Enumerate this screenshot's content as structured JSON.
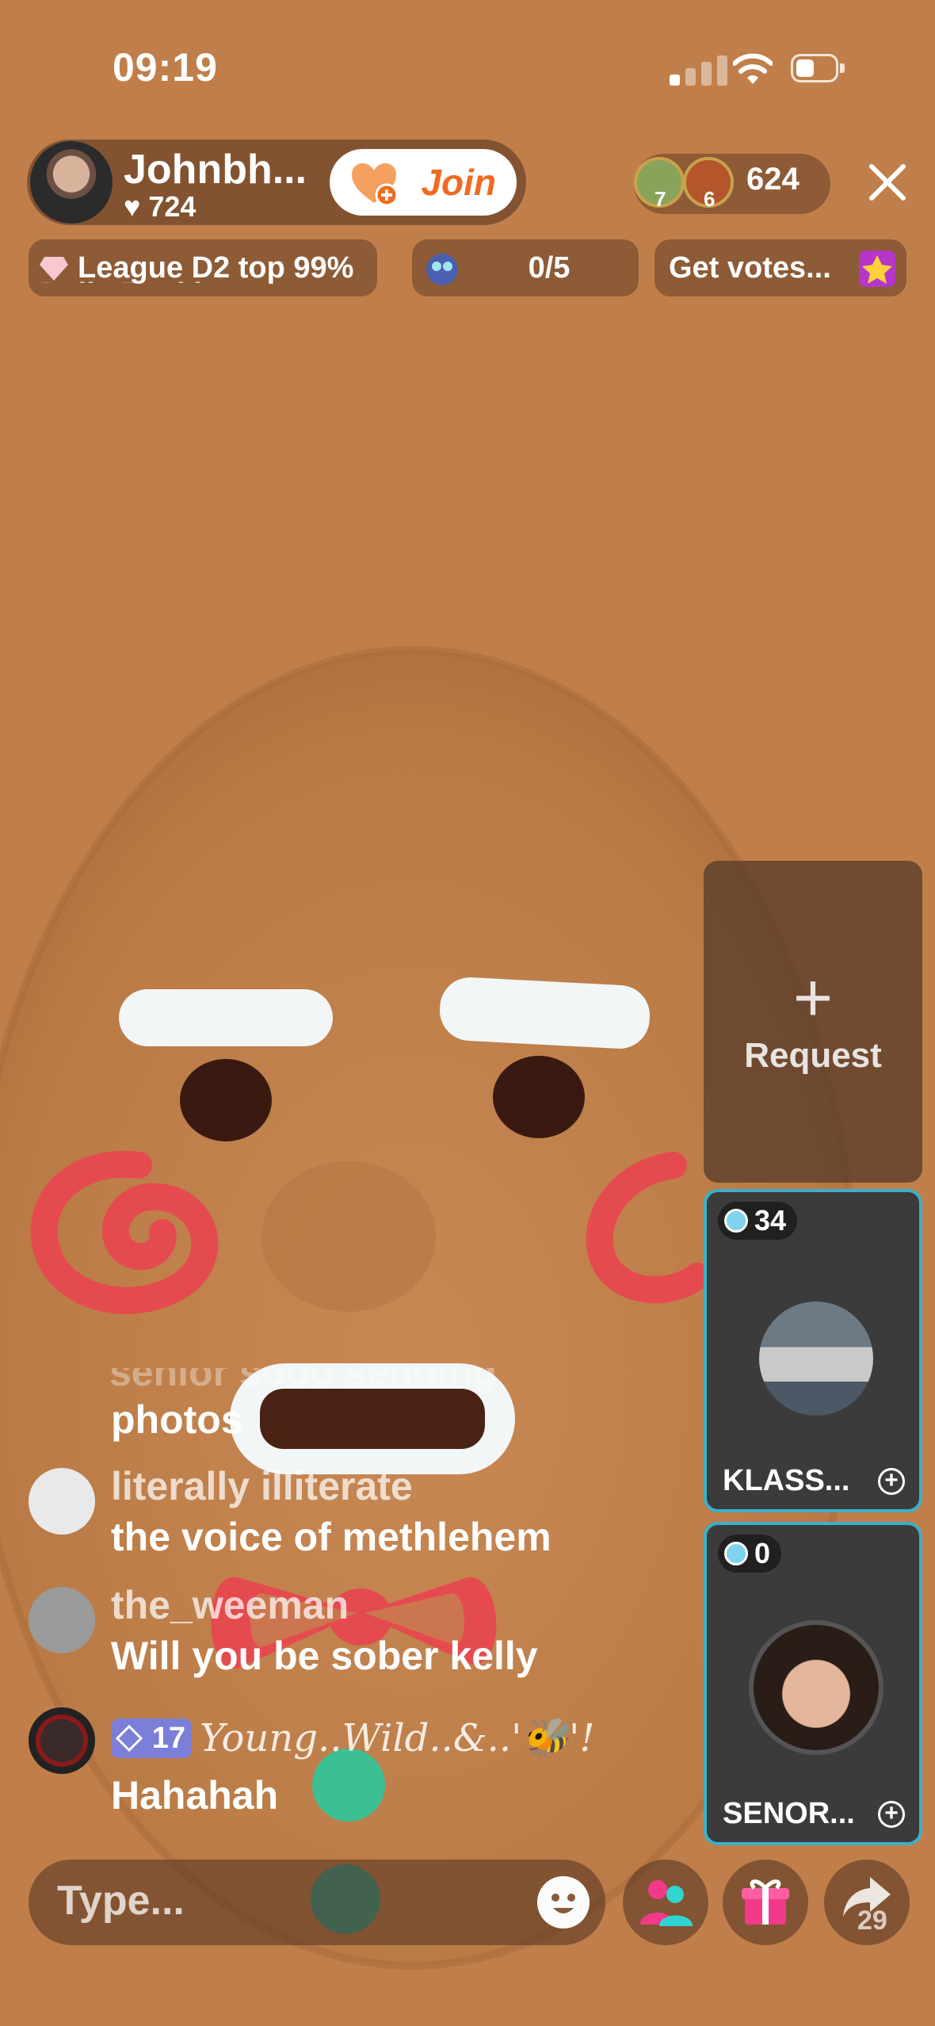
{
  "status_bar": {
    "time": "09:19"
  },
  "host": {
    "name": "Johnbh...",
    "likes": "724",
    "join_label": "Join"
  },
  "viewers": {
    "badge_1": "7",
    "badge_2": "6",
    "count": "624"
  },
  "info": {
    "league": "League D2 top 99%",
    "daily": "Daily Ranking",
    "quest_progress": "0/5",
    "votes_label": "Get votes..."
  },
  "request": {
    "plus": "+",
    "label": "Request"
  },
  "guests": [
    {
      "score": "34",
      "name": "KLASS...",
      "plus": "+"
    },
    {
      "score": "0",
      "name": "SENOR...",
      "plus": "+"
    }
  ],
  "chat": {
    "faded_line": "senior sooo sending",
    "items": [
      {
        "message": "photos"
      },
      {
        "user": "literally illiterate",
        "message": "the voice of methlehem"
      },
      {
        "user": "the_weeman",
        "message": "Will you be sober kelly"
      },
      {
        "level": "17",
        "user": "Young..Wild..&..'🐝'!",
        "message": "Hahahah"
      }
    ]
  },
  "bottom": {
    "type_placeholder": "Type...",
    "share_count": "29"
  },
  "colors": {
    "background": "#c07f4a",
    "accent": "#f06a1f",
    "guest_border": "#3ab0c9"
  }
}
